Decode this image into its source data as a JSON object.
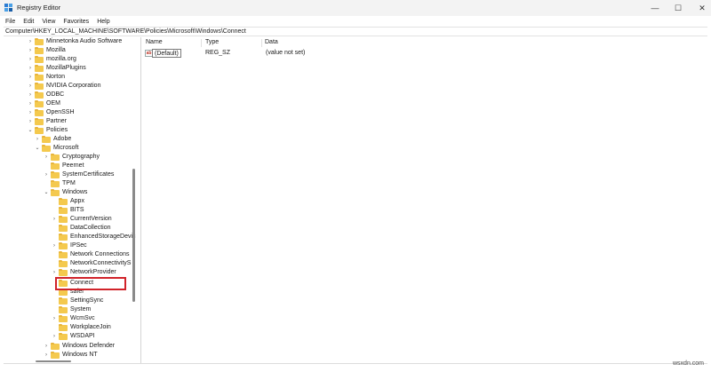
{
  "window": {
    "title": "Registry Editor",
    "minimize_glyph": "—",
    "maximize_glyph": "☐",
    "close_glyph": "✕"
  },
  "menu": [
    "File",
    "Edit",
    "View",
    "Favorites",
    "Help"
  ],
  "address": "Computer\\HKEY_LOCAL_MACHINE\\SOFTWARE\\Policies\\Microsoft\\Windows\\Connect",
  "tree": [
    {
      "label": "Minnetonka Audio Software",
      "expander": "›"
    },
    {
      "label": "Mozilla",
      "expander": "›"
    },
    {
      "label": "mozilla.org",
      "expander": "›"
    },
    {
      "label": "MozillaPlugins",
      "expander": "›"
    },
    {
      "label": "Norton",
      "expander": "›"
    },
    {
      "label": "NVIDIA Corporation",
      "expander": "›"
    },
    {
      "label": "ODBC",
      "expander": "›"
    },
    {
      "label": "OEM",
      "expander": "›"
    },
    {
      "label": "OpenSSH",
      "expander": "›"
    },
    {
      "label": "Partner",
      "expander": "›"
    },
    {
      "label": "Policies",
      "expander": "⌄"
    },
    {
      "label": "Adobe",
      "expander": "›"
    },
    {
      "label": "Microsoft",
      "expander": "⌄"
    },
    {
      "label": "Cryptography",
      "expander": "›"
    },
    {
      "label": "Peernet",
      "expander": ""
    },
    {
      "label": "SystemCertificates",
      "expander": "›"
    },
    {
      "label": "TPM",
      "expander": ""
    },
    {
      "label": "Windows",
      "expander": "⌄"
    },
    {
      "label": "Appx",
      "expander": ""
    },
    {
      "label": "BITS",
      "expander": ""
    },
    {
      "label": "CurrentVersion",
      "expander": "›"
    },
    {
      "label": "DataCollection",
      "expander": ""
    },
    {
      "label": "EnhancedStorageDevic",
      "expander": ""
    },
    {
      "label": "IPSec",
      "expander": "›"
    },
    {
      "label": "Network Connections",
      "expander": ""
    },
    {
      "label": "NetworkConnectivityS",
      "expander": ""
    },
    {
      "label": "NetworkProvider",
      "expander": "›"
    },
    {
      "label": "Connect",
      "expander": ""
    },
    {
      "label": "safer",
      "expander": ""
    },
    {
      "label": "SettingSync",
      "expander": ""
    },
    {
      "label": "System",
      "expander": ""
    },
    {
      "label": "WcmSvc",
      "expander": "›"
    },
    {
      "label": "WorkplaceJoin",
      "expander": ""
    },
    {
      "label": "WSDAPI",
      "expander": "›"
    },
    {
      "label": "Windows Defender",
      "expander": "›"
    },
    {
      "label": "Windows NT",
      "expander": "›"
    }
  ],
  "values_table": {
    "columns": [
      "Name",
      "Type",
      "Data"
    ],
    "rows": [
      {
        "icon": "ab",
        "name": "(Default)",
        "type": "REG_SZ",
        "data": "(value not set)"
      }
    ]
  },
  "highlight_color": "#d1232a",
  "watermark": "wsxdn.com"
}
